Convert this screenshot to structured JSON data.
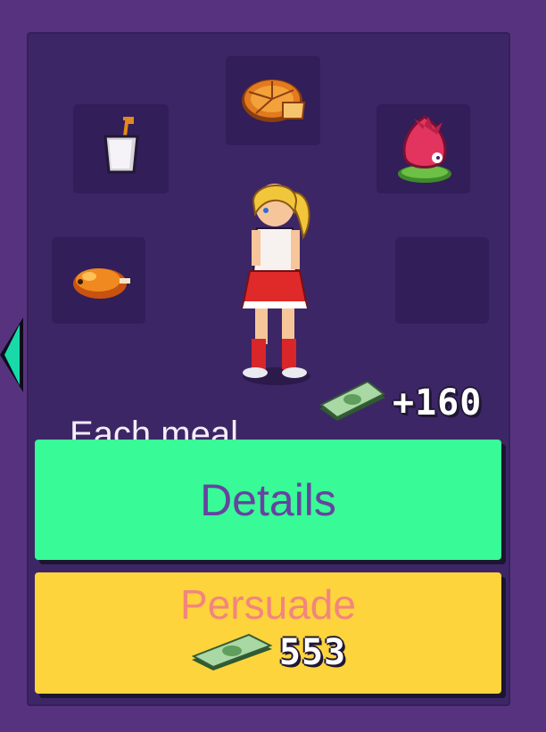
{
  "panel": {
    "caption": "Each meal",
    "reward": "+160",
    "food_slots": [
      {
        "slot": "top",
        "item": "pizza-icon"
      },
      {
        "slot": "top-left",
        "item": "milkshake-icon"
      },
      {
        "slot": "top-right",
        "item": "dragonfruit-icon"
      },
      {
        "slot": "mid-left",
        "item": "roast-chicken-icon"
      },
      {
        "slot": "mid-right",
        "item": "empty"
      }
    ],
    "character": "cheerleader-girl"
  },
  "buttons": {
    "details_label": "Details",
    "persuade_label": "Persuade",
    "persuade_cost": "553"
  },
  "colors": {
    "background": "#57337f",
    "panel": "#3d2666",
    "bubble": "#321e58",
    "details_button": "#38fa96",
    "details_text": "#6742a0",
    "persuade_button": "#fdd43c",
    "persuade_text": "#f2857d",
    "side_arrow": "#19d9a8"
  }
}
